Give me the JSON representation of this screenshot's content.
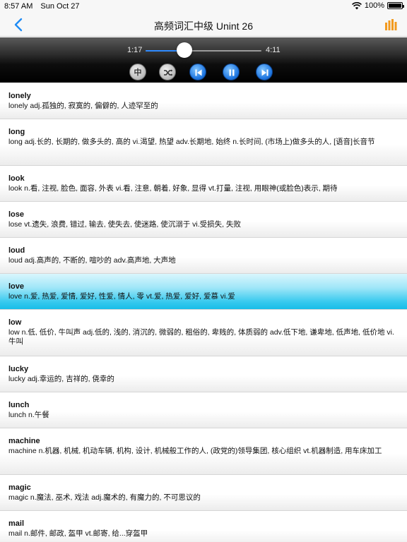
{
  "status": {
    "time": "8:57 AM",
    "date": "Sun Oct 27",
    "battery": "100%"
  },
  "nav": {
    "title": "高频词汇中级 Unint 26",
    "back_icon": "chevron-left-icon",
    "menu_icon": "bar-chart-icon",
    "accent": "#f29a1f"
  },
  "player": {
    "current": "1:17",
    "total": "4:11",
    "progress": 0.31,
    "lang_label": "中",
    "controls": [
      "language-toggle",
      "shuffle",
      "previous",
      "pause",
      "next"
    ]
  },
  "words": [
    {
      "word": "lonely",
      "def": "lonely  adj.孤独的, 寂寞的, 偏僻的, 人迹罕至的"
    },
    {
      "word": "long",
      "def": "long  adj.长的, 长期的, 做多头的, 高的 vi.渴望, 热望  adv.长期地, 始终 n.长时间, (市场上)做多头的人, [语音]长音节"
    },
    {
      "word": "look",
      "def": "look n.看, 注视, 脸色, 面容, 外表 vi.看, 注意, 朝着, 好象, 显得 vt.打量, 注视, 用眼神(或脸色)表示, 期待"
    },
    {
      "word": "lose",
      "def": "lose vt.遗失, 浪费, 错过, 输去, 使失去, 使迷路, 使沉溺于 vi.受损失, 失败"
    },
    {
      "word": "loud",
      "def": "loud  adj.高声的, 不断的, 喧吵的  adv.高声地, 大声地"
    },
    {
      "word": "love",
      "def": "love n.爱, 热爱, 爱情, 爱好, 性爱, 情人, 零 vt.爱, 热爱, 爱好, 爱慕 vi.爱"
    },
    {
      "word": "low",
      "def": "low n.低, 低价, 牛叫声  adj.低的, 浅的, 消沉的, 微弱的, 粗俗的, 卑贱的, 体质弱的  adv.低下地, 谦卑地, 低声地, 低价地 vi.牛叫"
    },
    {
      "word": "lucky",
      "def": "lucky  adj.幸运的, 吉祥的, 侥幸的"
    },
    {
      "word": "lunch",
      "def": "lunch n.午餐"
    },
    {
      "word": "machine",
      "def": "machine n.机器, 机械, 机动车辆, 机构, 设计, 机械般工作的人, (政党的)领导集团, 核心组织 vt.机器制造, 用车床加工"
    },
    {
      "word": "magic",
      "def": "magic n.魔法, 巫术, 戏法  adj.魔术的, 有魔力的, 不可思议的"
    },
    {
      "word": "mail",
      "def": "mail n.邮件, 邮政, 盔甲 vt.邮寄, 给...穿盔甲"
    }
  ],
  "selected_index": 5
}
